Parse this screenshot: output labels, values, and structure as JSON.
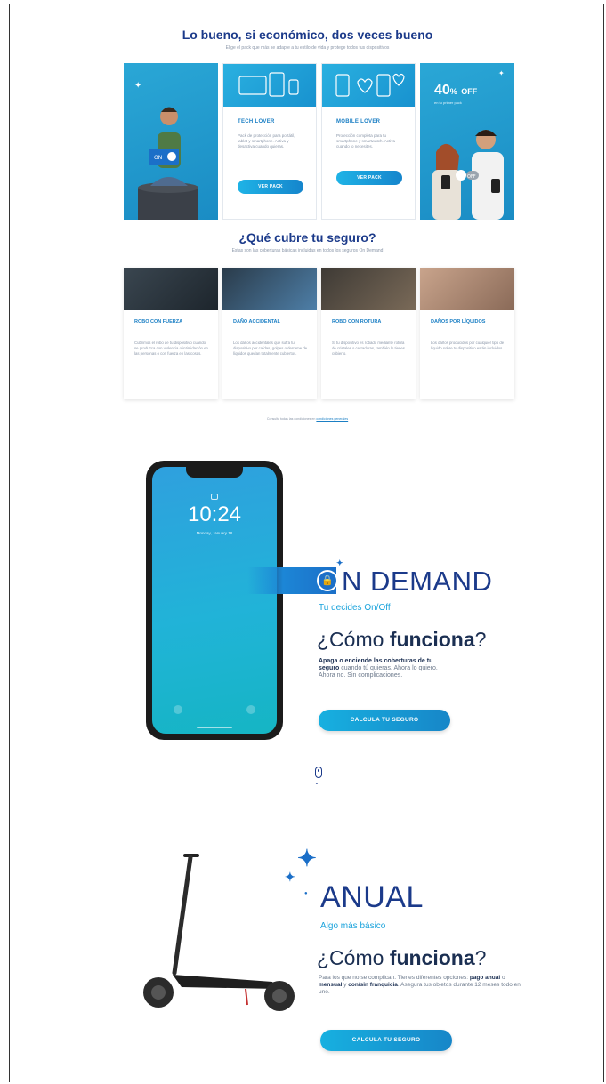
{
  "section1": {
    "title": "Lo bueno, si económico, dos veces bueno",
    "subtitle": "Elige el pack que más se adapte a tu estilo de vida y protege todos tus dispositivos",
    "cards": [
      {
        "title": "TECH LOVER",
        "text": "Pack de protección para portátil, tablet y smartphone. Activa y desactiva cuando quieras.",
        "button": "VER PACK"
      },
      {
        "title": "MOBILE LOVER",
        "text": "Protección completa para tu smartphone y smartwatch. Activa cuando lo necesites.",
        "button": "VER PACK"
      }
    ],
    "offer": {
      "percent": "40",
      "symbol": "%",
      "label": "OFF",
      "sub": "en tu primer pack"
    },
    "photo_badge": "ON",
    "photo_badge_off": "OFF"
  },
  "section2": {
    "title": "¿Qué cubre tu seguro?",
    "subtitle": "Estas son las coberturas básicas incluidas en todos los seguros On Demand",
    "coverages": [
      {
        "title": "ROBO CON FUERZA",
        "text": "Cubrimos el robo de tu dispositivo cuando se produzca con violencia o intimidación en las personas o con fuerza en las cosas."
      },
      {
        "title": "DAÑO ACCIDENTAL",
        "text": "Los daños accidentales que sufra tu dispositivo por caídas, golpes o derrame de líquidos quedan totalmente cubiertos."
      },
      {
        "title": "ROBO CON ROTURA",
        "text": "Si tu dispositivo es robado mediante rotura de cristales o cerraduras, también lo tienes cubierto."
      },
      {
        "title": "DAÑOS POR LÍQUIDOS",
        "text": "Los daños producidos por cualquier tipo de líquido sobre tu dispositivo están incluidos."
      }
    ],
    "legal_text": "Consulta todas las condiciones en",
    "legal_link": "condiciones generales"
  },
  "phone": {
    "time": "10:24",
    "date": "Monday, January 18"
  },
  "ondemand": {
    "badge": "🔒",
    "title": "N DEMAND",
    "tagline": "Tu decides On/Off",
    "como_pre": "¿Cómo ",
    "como_bold": "funciona",
    "como_post": "?",
    "body_bold": "Apaga o enciende las coberturas de tu seguro",
    "body_rest": " cuando tú quieras. Ahora lo quiero. Ahora no. Sin complicaciones.",
    "cta": "CALCULA TU SEGURO"
  },
  "anual": {
    "title": "ANUAL",
    "tagline": "Algo más básico",
    "como_pre": "¿Cómo ",
    "como_bold": "funciona",
    "como_post": "?",
    "body_1": "Para los que no se complican. Tienes diferentes opciones: ",
    "body_bold_1": "pago anual",
    "body_2": " o ",
    "body_bold_2": "mensual",
    "body_3": " y ",
    "body_bold_3": "con/sin franquicia",
    "body_4": ". Asegura tus objetos durante 12 meses todo en uno.",
    "cta": "CALCULA TU SEGURO"
  }
}
